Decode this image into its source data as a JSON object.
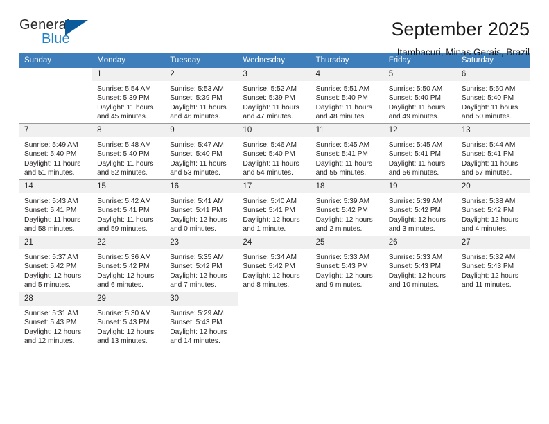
{
  "logo": {
    "word_one": "General",
    "word_two": "Blue",
    "triangle_icon": "triangle-icon",
    "brand_blue": "#1f7fc4",
    "triangle_blue": "#0a5a9c"
  },
  "header": {
    "title": "September 2025",
    "subtitle": "Itambacuri, Minas Gerais, Brazil"
  },
  "calendar": {
    "header_color": "#3d7ebb",
    "daynum_band_color": "#f0f0f0",
    "weekday_headers": [
      "Sunday",
      "Monday",
      "Tuesday",
      "Wednesday",
      "Thursday",
      "Friday",
      "Saturday"
    ],
    "weeks": [
      [
        {
          "day": "",
          "sunrise": "",
          "sunset": "",
          "daylight_line1": "",
          "daylight_line2": "",
          "blank": true
        },
        {
          "day": "1",
          "sunrise": "Sunrise: 5:54 AM",
          "sunset": "Sunset: 5:39 PM",
          "daylight_line1": "Daylight: 11 hours",
          "daylight_line2": "and 45 minutes."
        },
        {
          "day": "2",
          "sunrise": "Sunrise: 5:53 AM",
          "sunset": "Sunset: 5:39 PM",
          "daylight_line1": "Daylight: 11 hours",
          "daylight_line2": "and 46 minutes."
        },
        {
          "day": "3",
          "sunrise": "Sunrise: 5:52 AM",
          "sunset": "Sunset: 5:39 PM",
          "daylight_line1": "Daylight: 11 hours",
          "daylight_line2": "and 47 minutes."
        },
        {
          "day": "4",
          "sunrise": "Sunrise: 5:51 AM",
          "sunset": "Sunset: 5:40 PM",
          "daylight_line1": "Daylight: 11 hours",
          "daylight_line2": "and 48 minutes."
        },
        {
          "day": "5",
          "sunrise": "Sunrise: 5:50 AM",
          "sunset": "Sunset: 5:40 PM",
          "daylight_line1": "Daylight: 11 hours",
          "daylight_line2": "and 49 minutes."
        },
        {
          "day": "6",
          "sunrise": "Sunrise: 5:50 AM",
          "sunset": "Sunset: 5:40 PM",
          "daylight_line1": "Daylight: 11 hours",
          "daylight_line2": "and 50 minutes."
        }
      ],
      [
        {
          "day": "7",
          "sunrise": "Sunrise: 5:49 AM",
          "sunset": "Sunset: 5:40 PM",
          "daylight_line1": "Daylight: 11 hours",
          "daylight_line2": "and 51 minutes."
        },
        {
          "day": "8",
          "sunrise": "Sunrise: 5:48 AM",
          "sunset": "Sunset: 5:40 PM",
          "daylight_line1": "Daylight: 11 hours",
          "daylight_line2": "and 52 minutes."
        },
        {
          "day": "9",
          "sunrise": "Sunrise: 5:47 AM",
          "sunset": "Sunset: 5:40 PM",
          "daylight_line1": "Daylight: 11 hours",
          "daylight_line2": "and 53 minutes."
        },
        {
          "day": "10",
          "sunrise": "Sunrise: 5:46 AM",
          "sunset": "Sunset: 5:40 PM",
          "daylight_line1": "Daylight: 11 hours",
          "daylight_line2": "and 54 minutes."
        },
        {
          "day": "11",
          "sunrise": "Sunrise: 5:45 AM",
          "sunset": "Sunset: 5:41 PM",
          "daylight_line1": "Daylight: 11 hours",
          "daylight_line2": "and 55 minutes."
        },
        {
          "day": "12",
          "sunrise": "Sunrise: 5:45 AM",
          "sunset": "Sunset: 5:41 PM",
          "daylight_line1": "Daylight: 11 hours",
          "daylight_line2": "and 56 minutes."
        },
        {
          "day": "13",
          "sunrise": "Sunrise: 5:44 AM",
          "sunset": "Sunset: 5:41 PM",
          "daylight_line1": "Daylight: 11 hours",
          "daylight_line2": "and 57 minutes."
        }
      ],
      [
        {
          "day": "14",
          "sunrise": "Sunrise: 5:43 AM",
          "sunset": "Sunset: 5:41 PM",
          "daylight_line1": "Daylight: 11 hours",
          "daylight_line2": "and 58 minutes."
        },
        {
          "day": "15",
          "sunrise": "Sunrise: 5:42 AM",
          "sunset": "Sunset: 5:41 PM",
          "daylight_line1": "Daylight: 11 hours",
          "daylight_line2": "and 59 minutes."
        },
        {
          "day": "16",
          "sunrise": "Sunrise: 5:41 AM",
          "sunset": "Sunset: 5:41 PM",
          "daylight_line1": "Daylight: 12 hours",
          "daylight_line2": "and 0 minutes."
        },
        {
          "day": "17",
          "sunrise": "Sunrise: 5:40 AM",
          "sunset": "Sunset: 5:41 PM",
          "daylight_line1": "Daylight: 12 hours",
          "daylight_line2": "and 1 minute."
        },
        {
          "day": "18",
          "sunrise": "Sunrise: 5:39 AM",
          "sunset": "Sunset: 5:42 PM",
          "daylight_line1": "Daylight: 12 hours",
          "daylight_line2": "and 2 minutes."
        },
        {
          "day": "19",
          "sunrise": "Sunrise: 5:39 AM",
          "sunset": "Sunset: 5:42 PM",
          "daylight_line1": "Daylight: 12 hours",
          "daylight_line2": "and 3 minutes."
        },
        {
          "day": "20",
          "sunrise": "Sunrise: 5:38 AM",
          "sunset": "Sunset: 5:42 PM",
          "daylight_line1": "Daylight: 12 hours",
          "daylight_line2": "and 4 minutes."
        }
      ],
      [
        {
          "day": "21",
          "sunrise": "Sunrise: 5:37 AM",
          "sunset": "Sunset: 5:42 PM",
          "daylight_line1": "Daylight: 12 hours",
          "daylight_line2": "and 5 minutes."
        },
        {
          "day": "22",
          "sunrise": "Sunrise: 5:36 AM",
          "sunset": "Sunset: 5:42 PM",
          "daylight_line1": "Daylight: 12 hours",
          "daylight_line2": "and 6 minutes."
        },
        {
          "day": "23",
          "sunrise": "Sunrise: 5:35 AM",
          "sunset": "Sunset: 5:42 PM",
          "daylight_line1": "Daylight: 12 hours",
          "daylight_line2": "and 7 minutes."
        },
        {
          "day": "24",
          "sunrise": "Sunrise: 5:34 AM",
          "sunset": "Sunset: 5:42 PM",
          "daylight_line1": "Daylight: 12 hours",
          "daylight_line2": "and 8 minutes."
        },
        {
          "day": "25",
          "sunrise": "Sunrise: 5:33 AM",
          "sunset": "Sunset: 5:43 PM",
          "daylight_line1": "Daylight: 12 hours",
          "daylight_line2": "and 9 minutes."
        },
        {
          "day": "26",
          "sunrise": "Sunrise: 5:33 AM",
          "sunset": "Sunset: 5:43 PM",
          "daylight_line1": "Daylight: 12 hours",
          "daylight_line2": "and 10 minutes."
        },
        {
          "day": "27",
          "sunrise": "Sunrise: 5:32 AM",
          "sunset": "Sunset: 5:43 PM",
          "daylight_line1": "Daylight: 12 hours",
          "daylight_line2": "and 11 minutes."
        }
      ],
      [
        {
          "day": "28",
          "sunrise": "Sunrise: 5:31 AM",
          "sunset": "Sunset: 5:43 PM",
          "daylight_line1": "Daylight: 12 hours",
          "daylight_line2": "and 12 minutes."
        },
        {
          "day": "29",
          "sunrise": "Sunrise: 5:30 AM",
          "sunset": "Sunset: 5:43 PM",
          "daylight_line1": "Daylight: 12 hours",
          "daylight_line2": "and 13 minutes."
        },
        {
          "day": "30",
          "sunrise": "Sunrise: 5:29 AM",
          "sunset": "Sunset: 5:43 PM",
          "daylight_line1": "Daylight: 12 hours",
          "daylight_line2": "and 14 minutes."
        },
        {
          "day": "",
          "sunrise": "",
          "sunset": "",
          "daylight_line1": "",
          "daylight_line2": "",
          "blank": true
        },
        {
          "day": "",
          "sunrise": "",
          "sunset": "",
          "daylight_line1": "",
          "daylight_line2": "",
          "blank": true
        },
        {
          "day": "",
          "sunrise": "",
          "sunset": "",
          "daylight_line1": "",
          "daylight_line2": "",
          "blank": true
        },
        {
          "day": "",
          "sunrise": "",
          "sunset": "",
          "daylight_line1": "",
          "daylight_line2": "",
          "blank": true
        }
      ]
    ]
  }
}
